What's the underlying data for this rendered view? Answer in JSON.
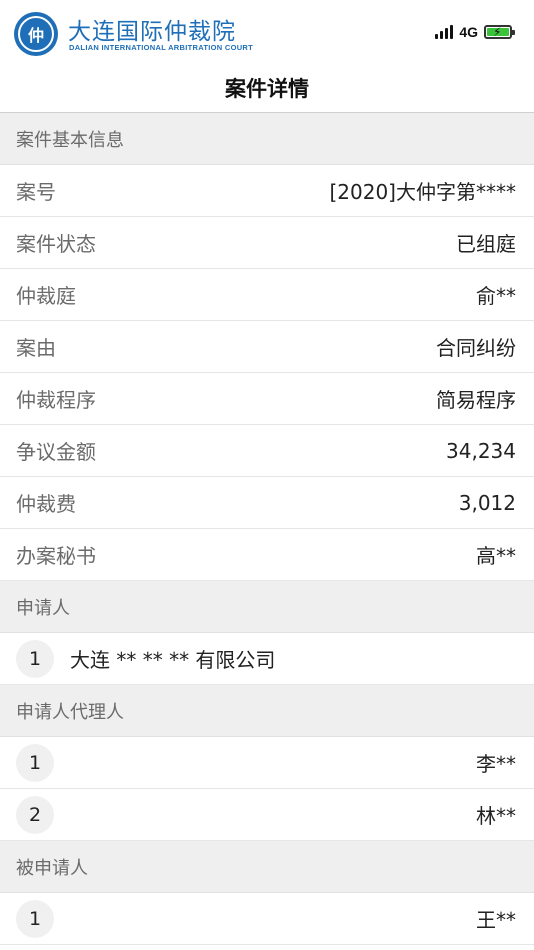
{
  "brand": {
    "name_cn": "大连国际仲裁院",
    "name_en": "DALIAN INTERNATIONAL ARBITRATION COURT",
    "logo_glyph": "DIAC",
    "color": "#1f6fb8"
  },
  "status_bar": {
    "network": "4G",
    "battery_color": "#3bc23b"
  },
  "nav": {
    "title": "案件详情"
  },
  "basic_info": {
    "header": "案件基本信息",
    "rows": [
      {
        "label": "案号",
        "value": "[2020]大仲字第****"
      },
      {
        "label": "案件状态",
        "value": "已组庭"
      },
      {
        "label": "仲裁庭",
        "value": "俞**"
      },
      {
        "label": "案由",
        "value": "合同纠纷"
      },
      {
        "label": "仲裁程序",
        "value": "简易程序"
      },
      {
        "label": "争议金额",
        "value": "34,234"
      },
      {
        "label": "仲裁费",
        "value": "3,012"
      },
      {
        "label": "办案秘书",
        "value": "高**"
      }
    ]
  },
  "applicant": {
    "header": "申请人",
    "items": [
      {
        "index": "1",
        "name": "大连 ** ** ** 有限公司"
      }
    ]
  },
  "applicant_agent": {
    "header": "申请人代理人",
    "items": [
      {
        "index": "1",
        "name": "李**"
      },
      {
        "index": "2",
        "name": "林**"
      }
    ]
  },
  "respondent": {
    "header": "被申请人",
    "items": [
      {
        "index": "1",
        "name": "王**"
      }
    ]
  }
}
